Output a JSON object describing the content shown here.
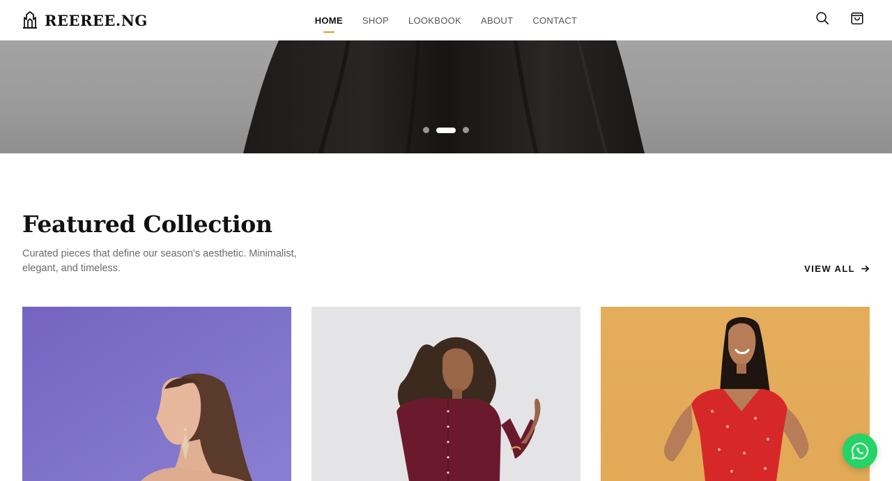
{
  "brand": {
    "name": "REEREE.NG",
    "logo_icon": "crown-logo-icon"
  },
  "nav": {
    "items": [
      {
        "label": "HOME",
        "active": true
      },
      {
        "label": "SHOP",
        "active": false
      },
      {
        "label": "LOOKBOOK",
        "active": false
      },
      {
        "label": "ABOUT",
        "active": false
      },
      {
        "label": "CONTACT",
        "active": false
      }
    ],
    "accent_color": "#e0a21f"
  },
  "header_actions": {
    "search_icon": "search-icon",
    "cart_icon": "shopping-bag-icon"
  },
  "hero": {
    "slide_count": 3,
    "active_slide": 2,
    "background_color": "#9c9c9c"
  },
  "featured": {
    "title": "Featured Collection",
    "description": "Curated pieces that define our season's aesthetic. Minimalist, elegant, and timeless.",
    "view_all_label": "VIEW ALL",
    "view_all_icon": "arrow-right-icon"
  },
  "products": [
    {
      "background": "#7d6fc6",
      "subject": "woman-profile-earrings"
    },
    {
      "background": "#e4e4e6",
      "subject": "woman-curly-hair-burgundy-shirt"
    },
    {
      "background": "#e3ad5f",
      "subject": "woman-smiling-red-floral-dress"
    }
  ],
  "whatsapp": {
    "icon": "whatsapp-icon",
    "color": "#25d366"
  }
}
